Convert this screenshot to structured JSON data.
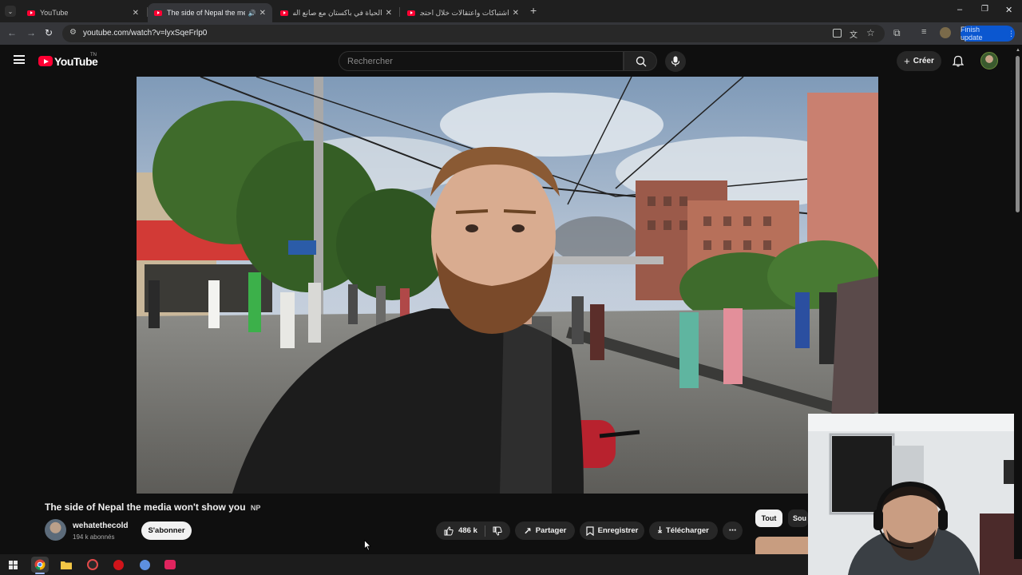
{
  "browser": {
    "tabs": [
      {
        "title": "YouTube",
        "active": false,
        "audio": false
      },
      {
        "title": "The side of Nepal the media",
        "active": true,
        "audio": true
      },
      {
        "title": "الحياة في باكستان مع صانع السلا",
        "active": false,
        "audio": false
      },
      {
        "title": "اشتباكات واعتقالات خلال احتجاجا",
        "active": false,
        "audio": false
      }
    ],
    "url": "youtube.com/watch?v=lyxSqeFrlp0",
    "finish_update_label": "Finish update",
    "brand_color": "#0b57d0"
  },
  "youtube": {
    "logo_text": "YouTube",
    "logo_tm": "TN",
    "search_placeholder": "Rechercher",
    "create_label": "Créer",
    "brand_color": "#ff0033"
  },
  "video": {
    "title": "The side of Nepal the media won't show you",
    "country_tag": "NP",
    "channel_name": "wehatethecold",
    "subscribers": "194 k abonnés",
    "subscribe_label": "S'abonner",
    "likes": "486 k",
    "share_label": "Partager",
    "save_label": "Enregistrer",
    "download_label": "Télécharger"
  },
  "chips": {
    "all_label": "Tout",
    "second_label": "Sou"
  },
  "icons": {
    "tabstrip": [
      "tab-list-icon",
      "youtube-favicon",
      "speaker-icon",
      "close-icon",
      "new-tab-icon",
      "minimize-icon",
      "restore-icon",
      "window-close-icon"
    ],
    "toolbar": [
      "back-icon",
      "forward-icon",
      "reload-icon",
      "site-info-icon",
      "install-icon",
      "translate-icon",
      "bookmark-star-icon",
      "extensions-icon",
      "media-control-icon",
      "profile-icon",
      "more-vert-icon"
    ],
    "youtube": [
      "menu-icon",
      "search-icon",
      "mic-icon",
      "plus-icon",
      "bell-icon"
    ],
    "actions": [
      "thumb-up-icon",
      "thumb-down-icon",
      "share-icon",
      "save-icon",
      "download-icon",
      "more-horiz-icon"
    ],
    "taskbar": [
      "windows-start-icon",
      "chrome-icon",
      "file-explorer-icon",
      "app-icon-1",
      "app-icon-2",
      "app-icon-3",
      "app-icon-4"
    ]
  }
}
